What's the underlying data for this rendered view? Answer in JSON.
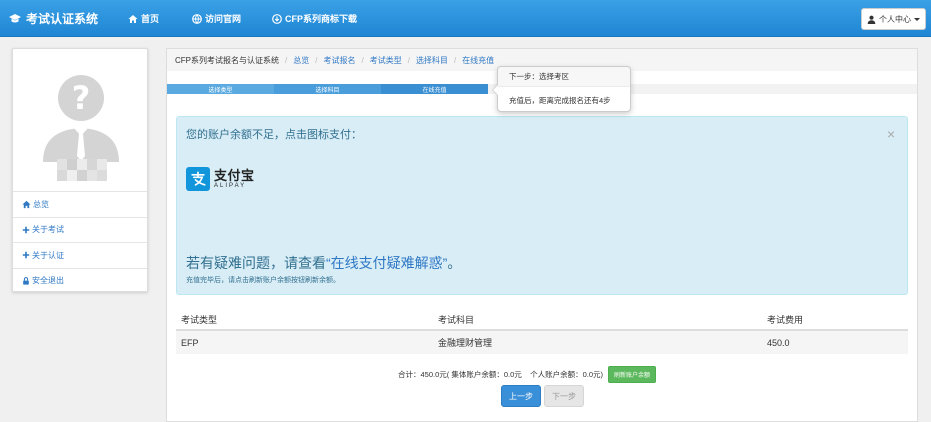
{
  "app": {
    "title": "考试认证系统"
  },
  "nav": {
    "items": [
      {
        "label": "首页"
      },
      {
        "label": "访问官网"
      },
      {
        "label": "CFP系列商标下载"
      }
    ],
    "user_menu": "个人中心"
  },
  "sidebar": {
    "items": [
      {
        "label": "总览"
      },
      {
        "label": "关于考试"
      },
      {
        "label": "关于认证"
      },
      {
        "label": "安全退出"
      }
    ]
  },
  "breadcrumb": [
    "CFP系列考试报名与认证系统",
    "总览",
    "考试报名",
    "考试类型",
    "选择科目",
    "在线充值"
  ],
  "steps": [
    "选择类型",
    "选择科目",
    "在线充值"
  ],
  "tooltip": {
    "title": "下一步：选择考区",
    "body": "充值后，距离完成报名还有4步"
  },
  "alert": {
    "title": "您的账户余额不足，点击图标支付：",
    "close": "×",
    "alipay_cn": "支付宝",
    "alipay_en": "ALIPAY",
    "help_prefix": "若有疑难问题，请查看",
    "help_link": "“在线支付疑难解惑”",
    "help_suffix": "。",
    "note": "充值完毕后，请点击刷新账户余额按钮刷新余额。"
  },
  "table": {
    "headers": [
      "考试类型",
      "考试科目",
      "考试费用"
    ],
    "rows": [
      [
        "EFP",
        "金融理财管理",
        "450.0"
      ]
    ]
  },
  "summary": {
    "text": "合计：450.0元( 集体账户余额：0.0元    个人账户余额：0.0元)",
    "refresh_label": "刷新账户余额"
  },
  "buttons": {
    "prev": "上一步",
    "next": "下一步"
  },
  "colors": {
    "nav": "#1f86d4",
    "link": "#2f78c4",
    "alert_bg": "#d9edf7",
    "success": "#5cb85c",
    "alipay": "#1296db"
  }
}
